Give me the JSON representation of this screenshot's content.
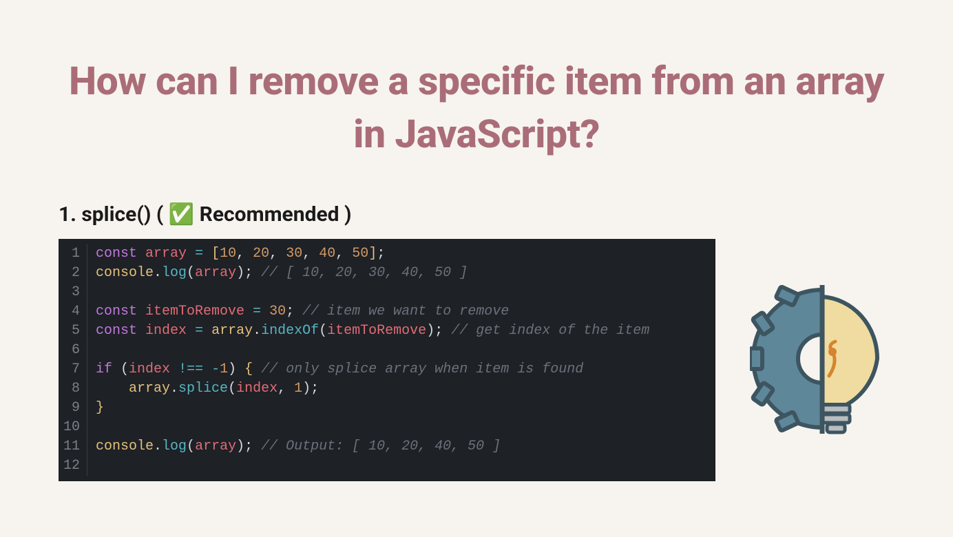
{
  "title": "How can I remove a specific item from an array in JavaScript?",
  "subheading": "1. splice() ( ✅ Recommended )",
  "code": {
    "lines": [
      {
        "n": 1,
        "html": "<span class='kw'>const</span> <span class='var'>array</span> <span class='op'>=</span> <span class='brk'>[</span><span class='num'>10</span><span class='pun'>,</span> <span class='num'>20</span><span class='pun'>,</span> <span class='num'>30</span><span class='pun'>,</span> <span class='num'>40</span><span class='pun'>,</span> <span class='num'>50</span><span class='brk'>]</span><span class='pun'>;</span>"
      },
      {
        "n": 2,
        "html": "<span class='obj'>console</span><span class='pun'>.</span><span class='fn'>log</span><span class='pun'>(</span><span class='var'>array</span><span class='pun'>);</span> <span class='cmt'>// [ 10, 20, 30, 40, 50 ]</span>"
      },
      {
        "n": 3,
        "html": ""
      },
      {
        "n": 4,
        "html": "<span class='kw'>const</span> <span class='var'>itemToRemove</span> <span class='op'>=</span> <span class='num'>30</span><span class='pun'>;</span> <span class='cmt'>// item we want to remove</span>"
      },
      {
        "n": 5,
        "html": "<span class='kw'>const</span> <span class='var'>index</span> <span class='op'>=</span> <span class='obj'>array</span><span class='pun'>.</span><span class='fn'>indexOf</span><span class='pun'>(</span><span class='var'>itemToRemove</span><span class='pun'>);</span> <span class='cmt'>// get index of the item</span>"
      },
      {
        "n": 6,
        "html": ""
      },
      {
        "n": 7,
        "html": "<span class='kw'>if</span> <span class='pun'>(</span><span class='var'>index</span> <span class='op'>!==</span> <span class='op'>-</span><span class='num'>1</span><span class='pun'>)</span> <span class='brk'>{</span> <span class='cmt'>// only splice array when item is found</span>"
      },
      {
        "n": 8,
        "html": "    <span class='obj'>array</span><span class='pun'>.</span><span class='fn'>splice</span><span class='pun'>(</span><span class='var'>index</span><span class='pun'>,</span> <span class='num'>1</span><span class='pun'>);</span>"
      },
      {
        "n": 9,
        "html": "<span class='brk'>}</span>"
      },
      {
        "n": 10,
        "html": ""
      },
      {
        "n": 11,
        "html": "<span class='obj'>console</span><span class='pun'>.</span><span class='fn'>log</span><span class='pun'>(</span><span class='var'>array</span><span class='pun'>);</span> <span class='cmt'>// Output: [ 10, 20, 40, 50 ]</span>"
      },
      {
        "n": 12,
        "html": ""
      }
    ]
  }
}
